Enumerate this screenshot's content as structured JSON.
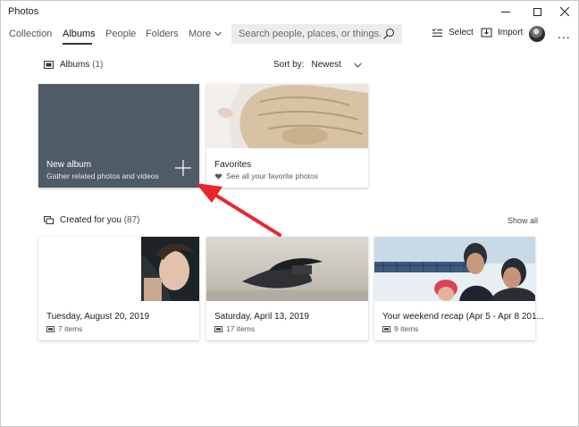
{
  "app": {
    "title": "Photos"
  },
  "window_controls": {
    "minimize": "minimize-icon",
    "maximize": "maximize-icon",
    "close": "close-icon"
  },
  "nav": {
    "tabs": [
      {
        "label": "Collection",
        "active": false
      },
      {
        "label": "Albums",
        "active": true
      },
      {
        "label": "People",
        "active": false
      },
      {
        "label": "Folders",
        "active": false
      },
      {
        "label": "More",
        "active": false
      }
    ],
    "search": {
      "placeholder": "Search people, places, or things..."
    },
    "select_label": "Select",
    "import_label": "Import",
    "more_options": "..."
  },
  "albums_section": {
    "title": "Albums",
    "count": "(1)",
    "sort_label": "Sort by:",
    "sort_value": "Newest",
    "new_album": {
      "title": "New album",
      "subtitle": "Gather related photos and videos"
    },
    "favorites": {
      "title": "Favorites",
      "subtitle": "See all your favorite photos"
    }
  },
  "created_section": {
    "title": "Created for you",
    "count": "(87)",
    "show_all": "Show all",
    "cards": [
      {
        "title": "Tuesday, August 20, 2019",
        "items": "7 items"
      },
      {
        "title": "Saturday, April 13, 2019",
        "items": "17 items"
      },
      {
        "title": "Your weekend recap (Apr 5 - Apr 8 201...",
        "items": "9 items"
      }
    ]
  },
  "colors": {
    "new_album_bg": "#4f5b66",
    "annotation_arrow": "#e8262b"
  }
}
